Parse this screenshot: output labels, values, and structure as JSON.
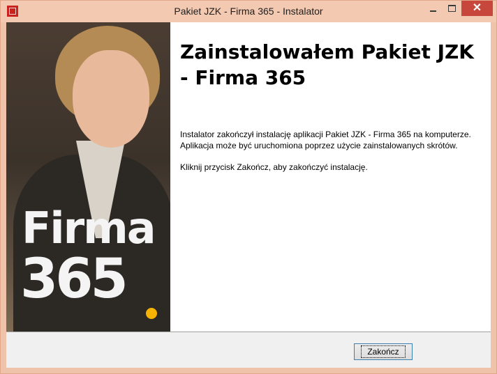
{
  "window": {
    "title": "Pakiet JZK - Firma 365 - Instalator",
    "app_icon": "jzk-app-icon",
    "controls": [
      "minimize-icon",
      "maximize-icon",
      "close-icon"
    ]
  },
  "banner": {
    "logo_line1": "Firma",
    "logo_line2": "365",
    "accent_color": "#f6b400"
  },
  "main": {
    "heading": "Zainstalowałem Pakiet JZK - Firma 365",
    "paragraph1": "Instalator zakończył instalację aplikacji Pakiet JZK - Firma 365 na komputerze. Aplikacja może być uruchomiona poprzez użycie zainstalowanych skrótów.",
    "paragraph2": "Kliknij przycisk Zakończ, aby zakończyć instalację."
  },
  "footer": {
    "finish_label": "Zakończ"
  },
  "colors": {
    "titlebar": "#f3c9b1",
    "close_button": "#c7473c"
  }
}
